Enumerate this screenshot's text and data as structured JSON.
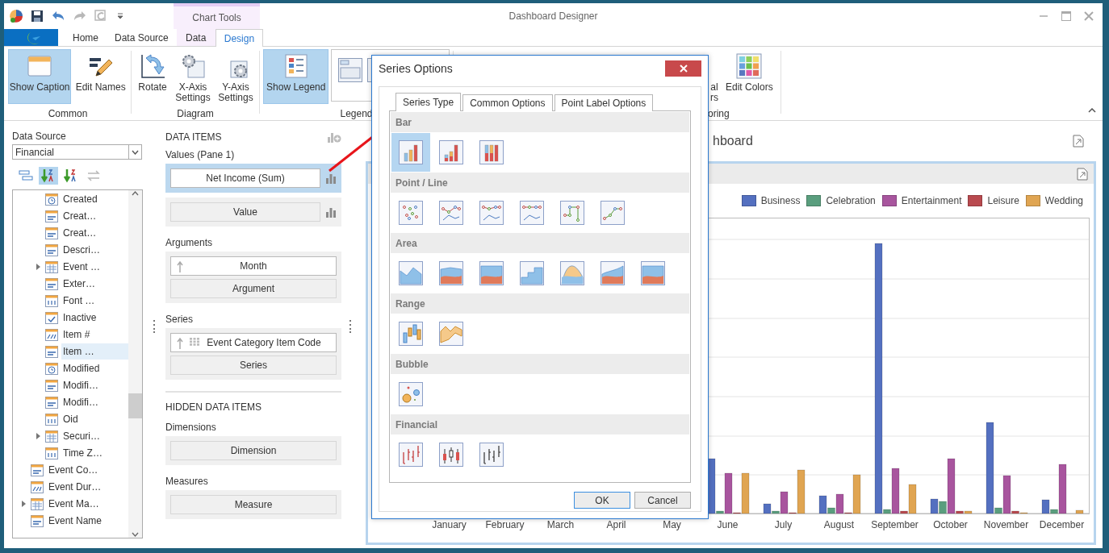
{
  "window": {
    "title": "Dashboard Designer"
  },
  "quick_access": [
    {
      "kind": "save",
      "disabled": false
    },
    {
      "kind": "undo",
      "disabled": false
    },
    {
      "kind": "redo",
      "disabled": true
    },
    {
      "kind": "refresh",
      "disabled": true
    }
  ],
  "context_tab_group": {
    "label": "Chart Tools"
  },
  "ribbon_tabs": [
    {
      "label": "Home",
      "selected": false,
      "contextual": false
    },
    {
      "label": "Data Source",
      "selected": false,
      "contextual": false
    },
    {
      "label": "Data",
      "selected": false,
      "contextual": true
    },
    {
      "label": "Design",
      "selected": true,
      "contextual": true
    }
  ],
  "ribbon_groups": [
    {
      "label": "Common",
      "buttons": [
        {
          "label": "Show Caption",
          "kind": "caption",
          "on": true
        },
        {
          "label": "Edit Names",
          "kind": "rename",
          "on": false
        }
      ]
    },
    {
      "label": "Diagram",
      "buttons": [
        {
          "label": "Rotate",
          "kind": "rotate",
          "on": false
        },
        {
          "label": "X-Axis Settings",
          "kind": "xaxis",
          "on": false
        },
        {
          "label": "Y-Axis Settings",
          "kind": "yaxis",
          "on": false
        }
      ]
    },
    {
      "label": "Legend",
      "buttons": [
        {
          "label": "Show Legend",
          "kind": "legend",
          "on": true
        },
        {
          "kind": "gallery"
        }
      ]
    },
    {
      "label": "oring",
      "buttons": [
        {
          "label": "al rs",
          "kind": "fragment",
          "on": false
        },
        {
          "label": "Edit Colors",
          "kind": "palette",
          "on": false
        }
      ]
    }
  ],
  "left_panel": {
    "data_source_label": "Data Source",
    "data_source": "Financial",
    "sort_buttons": [
      {
        "kind": "group",
        "selected": false
      },
      {
        "kind": "az",
        "selected": true
      },
      {
        "kind": "za",
        "selected": false
      },
      {
        "kind": "swap",
        "selected": false
      }
    ],
    "tree": {
      "nested_items": [
        {
          "label": "Created",
          "kind": "date",
          "expandable": false,
          "selected": false
        },
        {
          "label": "Creat…",
          "kind": "text",
          "expandable": false,
          "selected": false
        },
        {
          "label": "Creat…",
          "kind": "text",
          "expandable": false,
          "selected": false
        },
        {
          "label": "Descri…",
          "kind": "text",
          "expandable": false,
          "selected": false
        },
        {
          "label": "Event …",
          "kind": "table",
          "expandable": true,
          "selected": false
        },
        {
          "label": "Exter…",
          "kind": "text",
          "expandable": false,
          "selected": false
        },
        {
          "label": "Font …",
          "kind": "number",
          "expandable": false,
          "selected": false
        },
        {
          "label": "Inactive",
          "kind": "bool",
          "expandable": false,
          "selected": false
        },
        {
          "label": "Item #",
          "kind": "integer",
          "expandable": false,
          "selected": false
        },
        {
          "label": "Item …",
          "kind": "text",
          "expandable": false,
          "selected": true
        },
        {
          "label": "Modified",
          "kind": "date",
          "expandable": false,
          "selected": false
        },
        {
          "label": "Modifi…",
          "kind": "text",
          "expandable": false,
          "selected": false
        },
        {
          "label": "Modifi…",
          "kind": "text",
          "expandable": false,
          "selected": false
        },
        {
          "label": "Oid",
          "kind": "number",
          "expandable": false,
          "selected": false
        },
        {
          "label": "Securi…",
          "kind": "table",
          "expandable": true,
          "selected": false
        },
        {
          "label": "Time Z…",
          "kind": "number",
          "expandable": false,
          "selected": false
        }
      ],
      "items": [
        {
          "label": "Event Co…",
          "kind": "text",
          "expandable": false,
          "selected": false
        },
        {
          "label": "Event Dur…",
          "kind": "integer",
          "expandable": false,
          "selected": false
        },
        {
          "label": "Event Ma…",
          "kind": "table",
          "expandable": true,
          "selected": false
        },
        {
          "label": "Event Name",
          "kind": "text",
          "expandable": false,
          "selected": false
        }
      ]
    }
  },
  "data_items": {
    "title": "DATA ITEMS",
    "sections": [
      {
        "label": "Values (Pane 1)",
        "groups": [
          {
            "selected": true,
            "rows": [
              {
                "kind": "measure",
                "text": "Net Income (Sum)"
              }
            ]
          },
          {
            "selected": false,
            "rows": [
              {
                "kind": "measure_empty",
                "text": "Value"
              }
            ]
          }
        ]
      },
      {
        "label": "Arguments",
        "groups": [
          {
            "selected": false,
            "rows": [
              {
                "kind": "dimension",
                "text": "Month"
              },
              {
                "kind": "empty",
                "text": "Argument"
              }
            ]
          }
        ]
      },
      {
        "label": "Series",
        "groups": [
          {
            "selected": false,
            "rows": [
              {
                "kind": "series_dimension",
                "text": "Event Category Item Code"
              },
              {
                "kind": "empty",
                "text": "Series"
              }
            ]
          }
        ]
      }
    ],
    "hidden_title": "HIDDEN DATA ITEMS",
    "hidden_sections": [
      {
        "label": "Dimensions",
        "groups": [
          {
            "selected": false,
            "rows": [
              {
                "kind": "empty",
                "text": "Dimension"
              }
            ]
          }
        ]
      },
      {
        "label": "Measures",
        "groups": [
          {
            "selected": false,
            "rows": [
              {
                "kind": "empty",
                "text": "Measure"
              }
            ]
          }
        ]
      }
    ]
  },
  "dashboard": {
    "title": "hboard",
    "legend": [
      {
        "label": "Business",
        "color": "#5470c0"
      },
      {
        "label": "Celebration",
        "color": "#5a9e7e"
      },
      {
        "label": "Entertainment",
        "color": "#a8559e"
      },
      {
        "label": "Leisure",
        "color": "#b94a4f"
      },
      {
        "label": "Wedding",
        "color": "#e0a552"
      }
    ],
    "months": [
      "January",
      "February",
      "March",
      "April",
      "May",
      "June",
      "July",
      "August",
      "September",
      "October",
      "November",
      "December"
    ]
  },
  "dialog": {
    "title": "Series Options",
    "tabs": [
      {
        "label": "Series Type",
        "selected": true
      },
      {
        "label": "Common Options",
        "selected": false
      },
      {
        "label": "Point Label Options",
        "selected": false
      }
    ],
    "sections": [
      {
        "label": "Bar",
        "kind": "bar",
        "options": [
          {
            "selected": true
          },
          {
            "selected": false
          },
          {
            "selected": false
          }
        ]
      },
      {
        "label": "Point / Line",
        "kind": "line",
        "options": [
          {
            "selected": false
          },
          {
            "selected": false
          },
          {
            "selected": false
          },
          {
            "selected": false
          },
          {
            "selected": false
          },
          {
            "selected": false
          }
        ]
      },
      {
        "label": "Area",
        "kind": "area",
        "options": [
          {
            "selected": false
          },
          {
            "selected": false
          },
          {
            "selected": false
          },
          {
            "selected": false
          },
          {
            "selected": false
          },
          {
            "selected": false
          },
          {
            "selected": false
          }
        ]
      },
      {
        "label": "Range",
        "kind": "range",
        "options": [
          {
            "selected": false
          },
          {
            "selected": false
          }
        ]
      },
      {
        "label": "Bubble",
        "kind": "bubble",
        "options": [
          {
            "selected": false
          }
        ]
      },
      {
        "label": "Financial",
        "kind": "financial",
        "options": [
          {
            "selected": false
          },
          {
            "selected": false
          },
          {
            "selected": false
          }
        ]
      }
    ],
    "buttons": [
      {
        "label": "OK",
        "kind": "default"
      },
      {
        "label": "Cancel",
        "kind": "normal"
      }
    ]
  }
}
